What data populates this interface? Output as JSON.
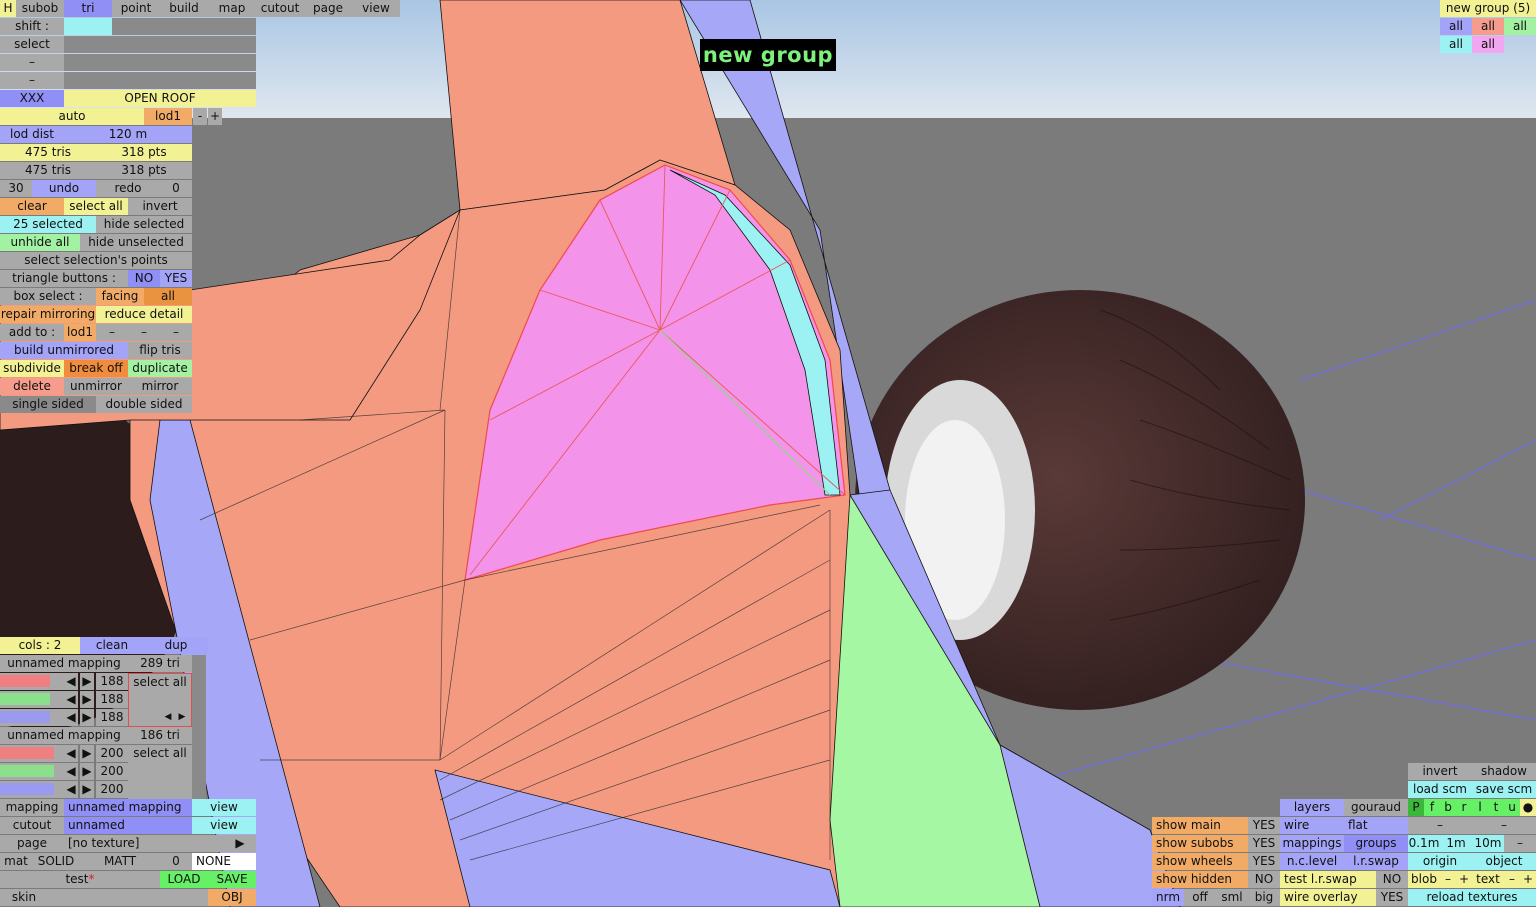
{
  "colors": {
    "orange_mesh": "#f39a80",
    "selected": "#f493ea",
    "side_blue": "#a7a7f7",
    "green": "#a6f7a3",
    "cyan": "#9cf2f2",
    "ground": "#7a7a7a",
    "sky_top": "#a9c6e4"
  },
  "overlay_label": "new group",
  "tabs": [
    {
      "label": "H"
    },
    {
      "label": "subob"
    },
    {
      "label": "tri"
    },
    {
      "label": "point"
    },
    {
      "label": "build"
    },
    {
      "label": "map"
    },
    {
      "label": "cutout"
    },
    {
      "label": "page"
    },
    {
      "label": "view"
    }
  ],
  "left": {
    "shift": "shift :",
    "select": "select",
    "dash": "–",
    "group_name": "XXX",
    "group_label": "OPEN ROOF",
    "auto": "auto",
    "lod": "lod1",
    "minus": "-",
    "plus": "+",
    "lod_dist": "lod dist",
    "lod_dist_val": "120 m",
    "tris1": "475 tris",
    "pts1": "318 pts",
    "tris2": "475 tris",
    "pts2": "318 pts",
    "undo_count": "30",
    "undo": "undo",
    "redo": "redo",
    "redo_count": "0",
    "clear": "clear",
    "select_all": "select all",
    "invert": "invert",
    "selected": "25 selected",
    "hide_selected": "hide selected",
    "unhide_all": "unhide all",
    "hide_unselected": "hide unselected",
    "select_points": "select selection's points",
    "tri_buttons": "triangle buttons :",
    "no": "NO",
    "yes": "YES",
    "box_select": "box select :",
    "facing": "facing",
    "all": "all",
    "repair": "repair mirroring",
    "reduce": "reduce detail",
    "add_to": "add to :",
    "add_lod": "lod1",
    "build_unmirrored": "build unmirrored",
    "flip_tris": "flip tris",
    "subdivide": "subdivide",
    "break_off": "break off",
    "duplicate": "duplicate",
    "delete": "delete",
    "unmirror": "unmirror",
    "mirror": "mirror",
    "single_sided": "single sided",
    "double_sided": "double sided"
  },
  "mapping": {
    "cols": "cols : 2",
    "clean": "clean",
    "dup": "dup",
    "m1_name": "unnamed mapping",
    "m1_tri": "289 tri",
    "m1_vals": [
      "188",
      "188",
      "188"
    ],
    "m2_name": "unnamed mapping",
    "m2_tri": "186 tri",
    "m2_vals": [
      "200",
      "200",
      "200"
    ],
    "select_all": "select all",
    "arrow_l": "◀",
    "arrow_r": "▶",
    "row_mapping": "mapping",
    "row_mapping_val": "unnamed mapping",
    "view": "view",
    "row_cutout": "cutout",
    "row_cutout_val": "unnamed",
    "row_page": "page",
    "row_page_val": "[no texture]",
    "row_page_arrow": "▶",
    "mat": "mat",
    "solid": "SOLID",
    "matt": "MATT",
    "mat_num": "0",
    "none": "NONE",
    "test": "test",
    "star": "*",
    "load": "LOAD",
    "save": "SAVE",
    "skin": "skin",
    "obj": "OBJ"
  },
  "groups": {
    "title": "new group (5)",
    "items": [
      {
        "label": "all"
      },
      {
        "label": "all"
      },
      {
        "label": "all"
      },
      {
        "label": "all"
      },
      {
        "label": "all"
      }
    ]
  },
  "view": {
    "invert": "invert",
    "shadow": "shadow",
    "load_scm": "load scm",
    "save_scm": "save scm",
    "letters": [
      "P",
      "f",
      "b",
      "r",
      "l",
      "t",
      "u",
      "●"
    ],
    "layers": "layers",
    "gouraud": "gouraud",
    "show_main": "show main",
    "show_main_val": "YES",
    "wire": "wire",
    "flat": "flat",
    "dash": "–",
    "show_subobs": "show subobs",
    "show_subobs_val": "YES",
    "mappings": "mappings",
    "groups": "groups",
    "d01": "0.1m",
    "d1": "1m",
    "d10": "10m",
    "dm": "–",
    "show_wheels": "show wheels",
    "show_wheels_val": "YES",
    "nclevel": "n.c.level",
    "lrswap": "l.r.swap",
    "origin": "origin",
    "object": "object",
    "show_hidden": "show hidden",
    "show_hidden_val": "NO",
    "test_lrswap": "test l.r.swap",
    "test_lrswap_val": "NO",
    "blob": "blob",
    "minus": "–",
    "plus": "+",
    "text": "text",
    "nrm": "nrm",
    "off": "off",
    "sml": "sml",
    "big": "big",
    "wire_overlay": "wire overlay",
    "wire_overlay_val": "YES",
    "reload": "reload textures"
  }
}
